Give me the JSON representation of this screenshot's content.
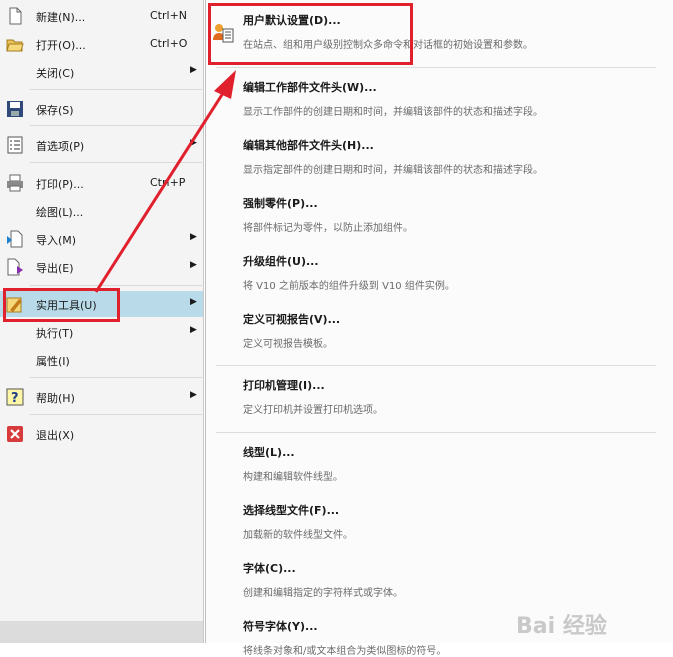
{
  "left_menu": {
    "items": [
      {
        "label": "新建(N)...",
        "shortcut": "Ctrl+N",
        "icon": "new-file-icon"
      },
      {
        "label": "打开(O)...",
        "shortcut": "Ctrl+O",
        "icon": "open-folder-icon"
      },
      {
        "label": "关闭(C)",
        "shortcut": "",
        "icon": ""
      },
      {
        "label": "保存(S)",
        "shortcut": "",
        "icon": "save-icon"
      },
      {
        "label": "首选项(P)",
        "shortcut": "",
        "icon": "preferences-icon"
      },
      {
        "label": "打印(P)...",
        "shortcut": "Ctrl+P",
        "icon": "printer-icon"
      },
      {
        "label": "绘图(L)...",
        "shortcut": "",
        "icon": ""
      },
      {
        "label": "导入(M)",
        "shortcut": "",
        "icon": "import-icon"
      },
      {
        "label": "导出(E)",
        "shortcut": "",
        "icon": "export-icon"
      },
      {
        "label": "实用工具(U)",
        "shortcut": "",
        "icon": "utilities-icon"
      },
      {
        "label": "执行(T)",
        "shortcut": "",
        "icon": ""
      },
      {
        "label": "属性(I)",
        "shortcut": "",
        "icon": ""
      },
      {
        "label": "帮助(H)",
        "shortcut": "",
        "icon": "help-icon"
      },
      {
        "label": "退出(X)",
        "shortcut": "",
        "icon": "exit-icon"
      }
    ]
  },
  "submenu": {
    "items": [
      {
        "title": "用户默认设置(D)...",
        "desc": "在站点、组和用户级别控制众多命令和对话框的初始设置和参数。"
      },
      {
        "title": "编辑工作部件文件头(W)...",
        "desc": "显示工作部件的创建日期和时间，并编辑该部件的状态和描述字段。"
      },
      {
        "title": "编辑其他部件文件头(H)...",
        "desc": "显示指定部件的创建日期和时间，并编辑该部件的状态和描述字段。"
      },
      {
        "title": "强制零件(P)...",
        "desc": "将部件标记为零件，以防止添加组件。"
      },
      {
        "title": "升级组件(U)...",
        "desc": "将 V10 之前版本的组件升级到 V10 组件实例。"
      },
      {
        "title": "定义可视报告(V)...",
        "desc": "定义可视报告模板。"
      },
      {
        "title": "打印机管理(I)...",
        "desc": "定义打印机并设置打印机选项。"
      },
      {
        "title": "线型(L)...",
        "desc": "构建和编辑软件线型。"
      },
      {
        "title": "选择线型文件(F)...",
        "desc": "加载新的软件线型文件。"
      },
      {
        "title": "字体(C)...",
        "desc": "创建和编辑指定的字符样式或字体。"
      },
      {
        "title": "符号字体(Y)...",
        "desc": "将线条对象和/或文本组合为类似图标的符号。"
      }
    ]
  },
  "watermark": "Bai 经验",
  "colors": {
    "highlight": "#b9dbe9",
    "annotation": "#e0202c"
  }
}
